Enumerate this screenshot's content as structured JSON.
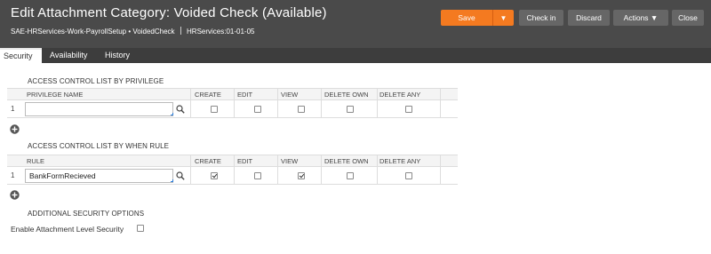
{
  "header": {
    "title": "Edit Attachment Category: Voided Check (Available)",
    "class_path": "SAE-HRServices-Work-PayrollSetup",
    "bullet": "•",
    "record_name": "VoidedCheck",
    "ruleset": "HRServices:01-01-05"
  },
  "toolbar": {
    "save_label": "Save",
    "save_menu_icon": "▼",
    "checkin_label": "Check in",
    "discard_label": "Discard",
    "actions_label": "Actions ▼",
    "close_label": "Close"
  },
  "tabs": [
    {
      "label": "Security",
      "active": true
    },
    {
      "label": "Availability",
      "active": false
    },
    {
      "label": "History",
      "active": false
    }
  ],
  "privilege_section": {
    "title": "ACCESS CONTROL LIST BY PRIVILEGE",
    "columns": [
      "PRIVILEGE NAME",
      "CREATE",
      "EDIT",
      "VIEW",
      "DELETE OWN",
      "DELETE ANY"
    ],
    "rows": [
      {
        "num": "1",
        "value": "",
        "create": false,
        "edit": false,
        "view": false,
        "delete_own": false,
        "delete_any": false
      }
    ]
  },
  "when_rule_section": {
    "title": "ACCESS CONTROL LIST BY WHEN RULE",
    "columns": [
      "RULE",
      "CREATE",
      "EDIT",
      "VIEW",
      "DELETE OWN",
      "DELETE ANY"
    ],
    "rows": [
      {
        "num": "1",
        "value": "BankFormRecieved",
        "create": true,
        "edit": false,
        "view": true,
        "delete_own": false,
        "delete_any": false
      }
    ]
  },
  "additional": {
    "title": "ADDITIONAL SECURITY OPTIONS",
    "enable_label": "Enable Attachment Level Security",
    "enable_checked": false
  },
  "icons": {
    "search": "search-icon",
    "add": "add-row-icon"
  },
  "colors": {
    "header_bg": "#4a4a4a",
    "save_button": "#f47a20",
    "button_gray": "#666666",
    "tabbar_bg": "#3d3d3d"
  }
}
